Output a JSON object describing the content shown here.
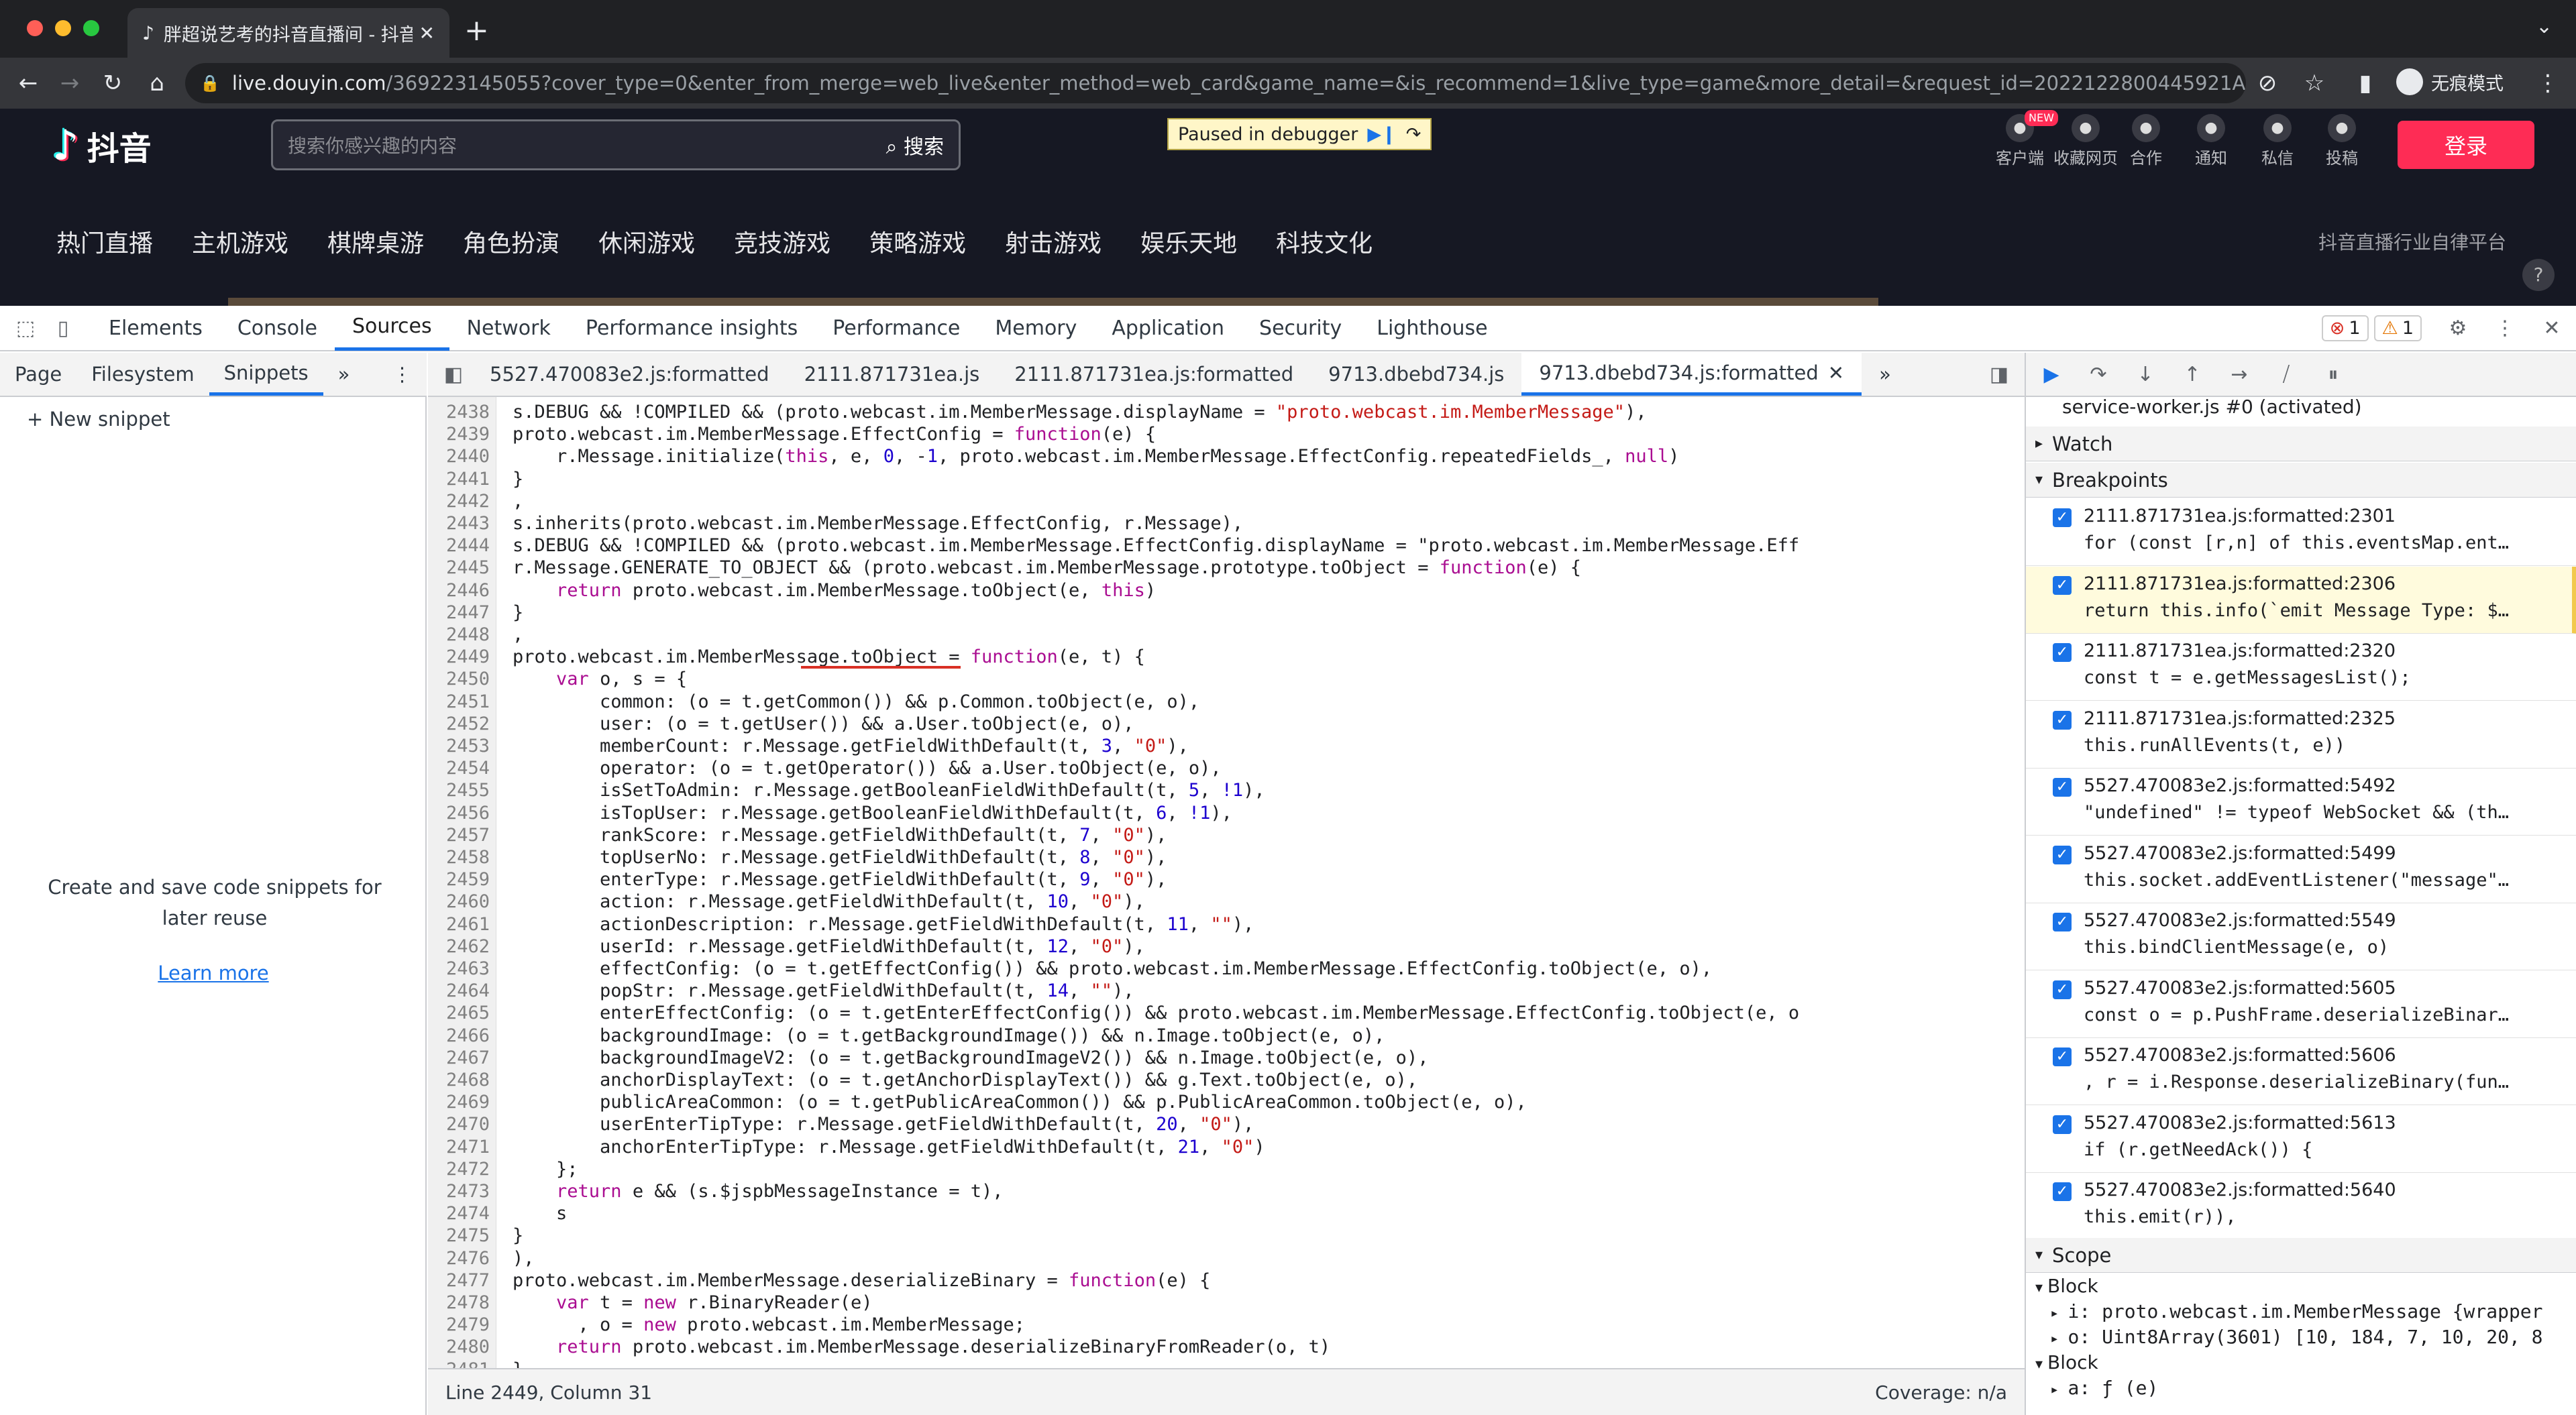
{
  "browser": {
    "tab_title": "胖超说艺考的抖音直播间 - 抖音直",
    "url_host": "live.douyin.com",
    "url_rest": "/369223145055?cover_type=0&enter_from_merge=web_live&enter_method=web_card&game_name=&is_recommend=1&live_type=game&more_detail=&request_id=2022122800445921A71BCBBA91707087C...",
    "profile": "无痕模式"
  },
  "page": {
    "logo_text": "抖音",
    "search_placeholder": "搜索你感兴趣的内容",
    "search_button": "搜索",
    "paused_text": "Paused in debugger",
    "header_icons": [
      {
        "label": "客户端",
        "icon": "desktop-icon",
        "badge": "NEW"
      },
      {
        "label": "收藏网页",
        "icon": "star-icon"
      },
      {
        "label": "合作",
        "icon": "handshake-icon"
      },
      {
        "label": "通知",
        "icon": "bell-icon"
      },
      {
        "label": "私信",
        "icon": "message-icon"
      },
      {
        "label": "投稿",
        "icon": "upload-icon"
      }
    ],
    "login": "登录",
    "nav": [
      "热门直播",
      "主机游戏",
      "棋牌桌游",
      "角色扮演",
      "休闲游戏",
      "竞技游戏",
      "策略游戏",
      "射击游戏",
      "娱乐天地",
      "科技文化"
    ],
    "nav_right": "抖音直播行业自律平台"
  },
  "devtools": {
    "tabs": [
      "Elements",
      "Console",
      "Sources",
      "Network",
      "Performance insights",
      "Performance",
      "Memory",
      "Application",
      "Security",
      "Lighthouse"
    ],
    "active_tab": "Sources",
    "error_count": "1",
    "warning_count": "1",
    "sub_tabs": [
      "Page",
      "Filesystem",
      "Snippets"
    ],
    "new_snippet": "+ New snippet",
    "snippets_empty": "Create and save code snippets for later reuse",
    "learn_more": "Learn more",
    "file_tabs": [
      "5527.470083e2.js:formatted",
      "2111.871731ea.js",
      "2111.871731ea.js:formatted",
      "9713.dbebd734.js",
      "9713.dbebd734.js:formatted"
    ],
    "status_left": "Line 2449, Column 31",
    "status_right": "Coverage: n/a",
    "service_worker": "service-worker.js #0 (activated)",
    "watch": "Watch",
    "breakpoints_title": "Breakpoints",
    "breakpoints": [
      {
        "loc": "2111.871731ea.js:formatted:2301",
        "code": "for (const [r,n] of this.eventsMap.ent…"
      },
      {
        "loc": "2111.871731ea.js:formatted:2306",
        "code": "return this.info(`emit Message Type: $…"
      },
      {
        "loc": "2111.871731ea.js:formatted:2320",
        "code": "const t = e.getMessagesList();"
      },
      {
        "loc": "2111.871731ea.js:formatted:2325",
        "code": "this.runAllEvents(t, e))"
      },
      {
        "loc": "5527.470083e2.js:formatted:5492",
        "code": "\"undefined\" != typeof WebSocket && (th…"
      },
      {
        "loc": "5527.470083e2.js:formatted:5499",
        "code": "this.socket.addEventListener(\"message\"…"
      },
      {
        "loc": "5527.470083e2.js:formatted:5549",
        "code": "this.bindClientMessage(e, o)"
      },
      {
        "loc": "5527.470083e2.js:formatted:5605",
        "code": "const o = p.PushFrame.deserializeBinar…"
      },
      {
        "loc": "5527.470083e2.js:formatted:5606",
        "code": ", r = i.Response.deserializeBinary(fun…"
      },
      {
        "loc": "5527.470083e2.js:formatted:5613",
        "code": "if (r.getNeedAck()) {"
      },
      {
        "loc": "5527.470083e2.js:formatted:5640",
        "code": "this.emit(r)),"
      }
    ],
    "scope_title": "Scope",
    "scope": [
      {
        "text": "Block",
        "kind": "head"
      },
      {
        "text": "i: proto.webcast.im.MemberMessage {wrapper",
        "kind": "item"
      },
      {
        "text": "o: Uint8Array(3601) [10, 184, 7, 10, 20, 8",
        "kind": "item"
      },
      {
        "text": "Block",
        "kind": "head"
      },
      {
        "text": "a: ƒ (e)",
        "kind": "item"
      }
    ],
    "code": [
      {
        "n": "2438",
        "t": "s.DEBUG && !COMPILED && (proto.webcast.im.MemberMessage.displayName = \"proto.webcast.im.MemberMessage\"),"
      },
      {
        "n": "2439",
        "t": "proto.webcast.im.MemberMessage.EffectConfig = function(e) {"
      },
      {
        "n": "2440",
        "t": "    r.Message.initialize(this, e, 0, -1, proto.webcast.im.MemberMessage.EffectConfig.repeatedFields_, null)"
      },
      {
        "n": "2441",
        "t": "}"
      },
      {
        "n": "2442",
        "t": ","
      },
      {
        "n": "2443",
        "t": "s.inherits(proto.webcast.im.MemberMessage.EffectConfig, r.Message),"
      },
      {
        "n": "2444",
        "t": "s.DEBUG && !COMPILED && (proto.webcast.im.MemberMessage.EffectConfig.displayName = \"proto.webcast.im.MemberMessage.Eff"
      },
      {
        "n": "2445",
        "t": "r.Message.GENERATE_TO_OBJECT && (proto.webcast.im.MemberMessage.prototype.toObject = function(e) {"
      },
      {
        "n": "2446",
        "t": "    return proto.webcast.im.MemberMessage.toObject(e, this)"
      },
      {
        "n": "2447",
        "t": "}"
      },
      {
        "n": "2448",
        "t": ","
      },
      {
        "n": "2449",
        "t": "proto.webcast.im.MemberMessage.toObject = function(e, t) {"
      },
      {
        "n": "2450",
        "t": "    var o, s = {"
      },
      {
        "n": "2451",
        "t": "        common: (o = t.getCommon()) && p.Common.toObject(e, o),"
      },
      {
        "n": "2452",
        "t": "        user: (o = t.getUser()) && a.User.toObject(e, o),"
      },
      {
        "n": "2453",
        "t": "        memberCount: r.Message.getFieldWithDefault(t, 3, \"0\"),"
      },
      {
        "n": "2454",
        "t": "        operator: (o = t.getOperator()) && a.User.toObject(e, o),"
      },
      {
        "n": "2455",
        "t": "        isSetToAdmin: r.Message.getBooleanFieldWithDefault(t, 5, !1),"
      },
      {
        "n": "2456",
        "t": "        isTopUser: r.Message.getBooleanFieldWithDefault(t, 6, !1),"
      },
      {
        "n": "2457",
        "t": "        rankScore: r.Message.getFieldWithDefault(t, 7, \"0\"),"
      },
      {
        "n": "2458",
        "t": "        topUserNo: r.Message.getFieldWithDefault(t, 8, \"0\"),"
      },
      {
        "n": "2459",
        "t": "        enterType: r.Message.getFieldWithDefault(t, 9, \"0\"),"
      },
      {
        "n": "2460",
        "t": "        action: r.Message.getFieldWithDefault(t, 10, \"0\"),"
      },
      {
        "n": "2461",
        "t": "        actionDescription: r.Message.getFieldWithDefault(t, 11, \"\"),"
      },
      {
        "n": "2462",
        "t": "        userId: r.Message.getFieldWithDefault(t, 12, \"0\"),"
      },
      {
        "n": "2463",
        "t": "        effectConfig: (o = t.getEffectConfig()) && proto.webcast.im.MemberMessage.EffectConfig.toObject(e, o),"
      },
      {
        "n": "2464",
        "t": "        popStr: r.Message.getFieldWithDefault(t, 14, \"\"),"
      },
      {
        "n": "2465",
        "t": "        enterEffectConfig: (o = t.getEnterEffectConfig()) && proto.webcast.im.MemberMessage.EffectConfig.toObject(e, o"
      },
      {
        "n": "2466",
        "t": "        backgroundImage: (o = t.getBackgroundImage()) && n.Image.toObject(e, o),"
      },
      {
        "n": "2467",
        "t": "        backgroundImageV2: (o = t.getBackgroundImageV2()) && n.Image.toObject(e, o),"
      },
      {
        "n": "2468",
        "t": "        anchorDisplayText: (o = t.getAnchorDisplayText()) && g.Text.toObject(e, o),"
      },
      {
        "n": "2469",
        "t": "        publicAreaCommon: (o = t.getPublicAreaCommon()) && p.PublicAreaCommon.toObject(e, o),"
      },
      {
        "n": "2470",
        "t": "        userEnterTipType: r.Message.getFieldWithDefault(t, 20, \"0\"),"
      },
      {
        "n": "2471",
        "t": "        anchorEnterTipType: r.Message.getFieldWithDefault(t, 21, \"0\")"
      },
      {
        "n": "2472",
        "t": "    };"
      },
      {
        "n": "2473",
        "t": "    return e && (s.$jspbMessageInstance = t),"
      },
      {
        "n": "2474",
        "t": "    s"
      },
      {
        "n": "2475",
        "t": "}"
      },
      {
        "n": "2476",
        "t": "),"
      },
      {
        "n": "2477",
        "t": "proto.webcast.im.MemberMessage.deserializeBinary = function(e) {"
      },
      {
        "n": "2478",
        "t": "    var t = new r.BinaryReader(e)"
      },
      {
        "n": "2479",
        "t": "      , o = new proto.webcast.im.MemberMessage;"
      },
      {
        "n": "2480",
        "t": "    return proto.webcast.im.MemberMessage.deserializeBinaryFromReader(o, t)"
      },
      {
        "n": "2481",
        "t": "}"
      }
    ]
  }
}
